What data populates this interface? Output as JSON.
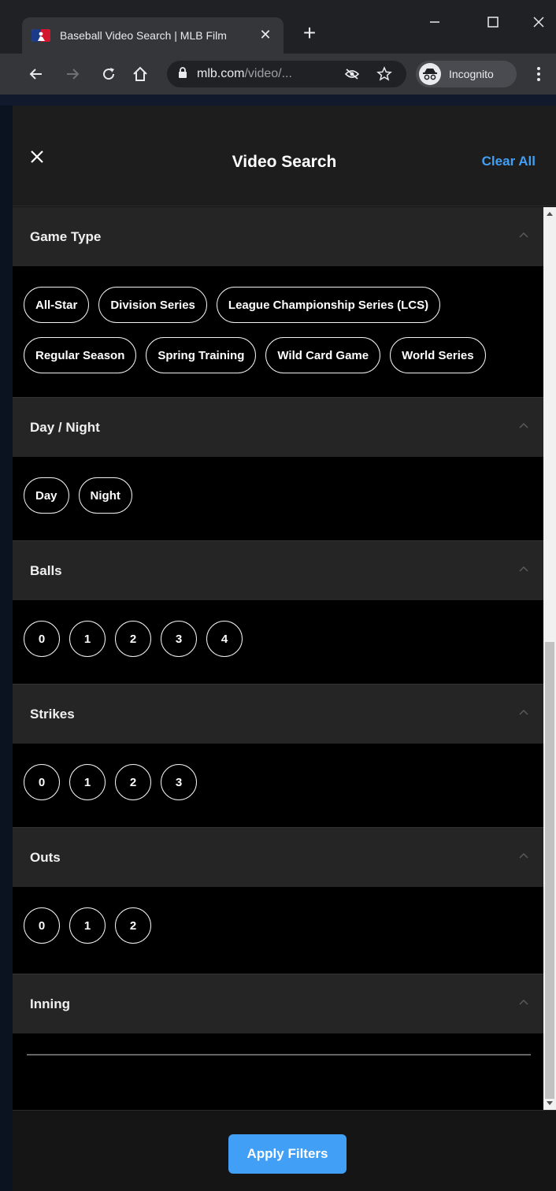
{
  "browser": {
    "tab_title": "Baseball Video Search | MLB Film",
    "tab_close": "✕",
    "new_tab": "+",
    "url_domain": "mlb.com",
    "url_path": "/video/...",
    "incognito_label": "Incognito"
  },
  "panel": {
    "title": "Video Search",
    "clear_all": "Clear All",
    "apply_label": "Apply Filters",
    "accent": "#41a0f6"
  },
  "sections": {
    "game_type": {
      "title": "Game Type",
      "options": [
        "All-Star",
        "Division Series",
        "League Championship Series (LCS)",
        "Regular Season",
        "Spring Training",
        "Wild Card Game",
        "World Series"
      ]
    },
    "day_night": {
      "title": "Day / Night",
      "options": [
        "Day",
        "Night"
      ]
    },
    "balls": {
      "title": "Balls",
      "options": [
        "0",
        "1",
        "2",
        "3",
        "4"
      ]
    },
    "strikes": {
      "title": "Strikes",
      "options": [
        "0",
        "1",
        "2",
        "3"
      ]
    },
    "outs": {
      "title": "Outs",
      "options": [
        "0",
        "1",
        "2"
      ]
    },
    "inning": {
      "title": "Inning"
    }
  }
}
